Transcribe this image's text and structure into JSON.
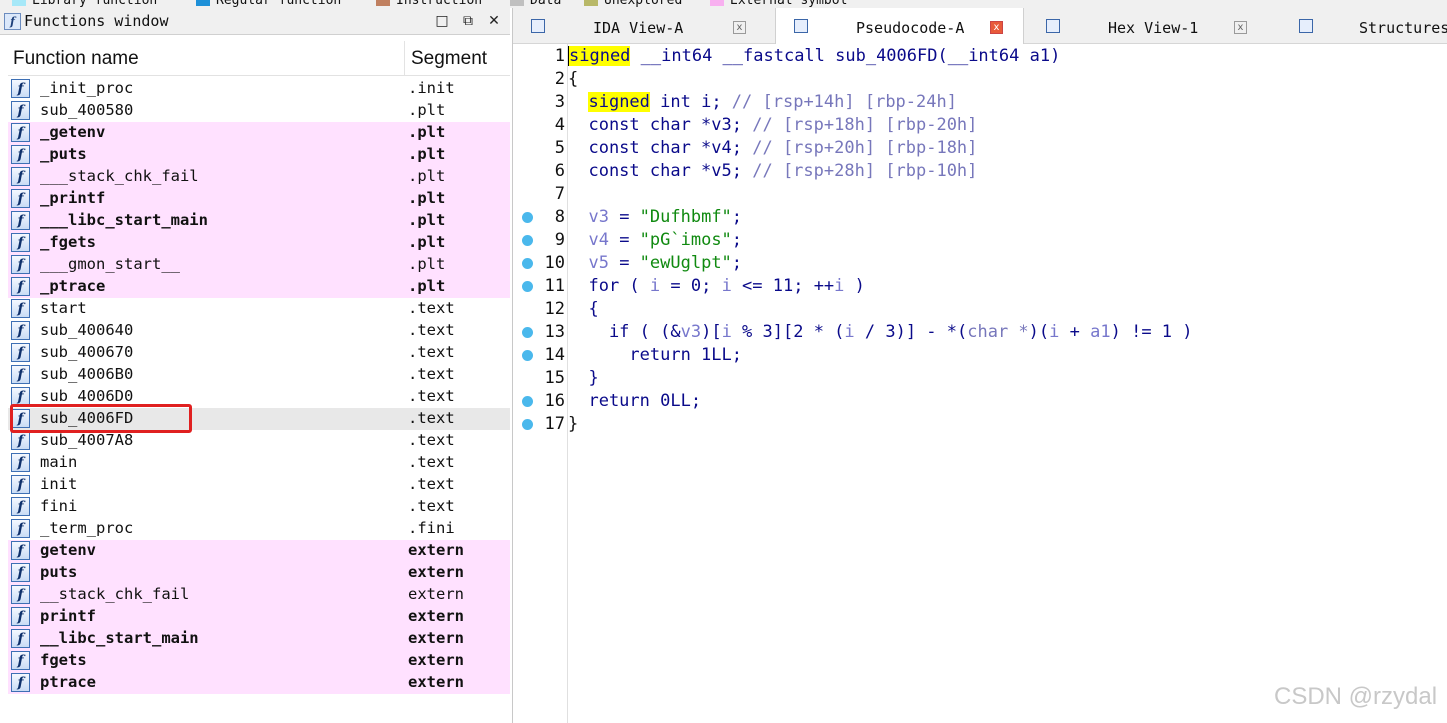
{
  "legend": [
    {
      "label": "Library function",
      "color": "#a6e8f8"
    },
    {
      "label": "Regular function",
      "color": "#1e90d8"
    },
    {
      "label": "Instruction",
      "color": "#c08060"
    },
    {
      "label": "Data",
      "color": "#c0c0c0"
    },
    {
      "label": "Unexplored",
      "color": "#b8b868"
    },
    {
      "label": "External symbol",
      "color": "#f8b0f0"
    }
  ],
  "functions_window": {
    "title": "Functions window",
    "restore_btn": "□",
    "float_btn": "⧉",
    "close_btn": "✕",
    "col_name": "Function name",
    "col_segment": "Segment",
    "rows": [
      {
        "name": "_init_proc",
        "segment": ".init",
        "style": "normal"
      },
      {
        "name": "sub_400580",
        "segment": ".plt",
        "style": "normal"
      },
      {
        "name": "_getenv",
        "segment": ".plt",
        "style": "extbold"
      },
      {
        "name": "_puts",
        "segment": ".plt",
        "style": "extbold"
      },
      {
        "name": "___stack_chk_fail",
        "segment": ".plt",
        "style": "ext"
      },
      {
        "name": "_printf",
        "segment": ".plt",
        "style": "extbold"
      },
      {
        "name": "___libc_start_main",
        "segment": ".plt",
        "style": "extbold"
      },
      {
        "name": "_fgets",
        "segment": ".plt",
        "style": "extbold"
      },
      {
        "name": "___gmon_start__",
        "segment": ".plt",
        "style": "ext"
      },
      {
        "name": "_ptrace",
        "segment": ".plt",
        "style": "extbold"
      },
      {
        "name": "start",
        "segment": ".text",
        "style": "normal"
      },
      {
        "name": "sub_400640",
        "segment": ".text",
        "style": "normal"
      },
      {
        "name": "sub_400670",
        "segment": ".text",
        "style": "normal"
      },
      {
        "name": "sub_4006B0",
        "segment": ".text",
        "style": "normal"
      },
      {
        "name": "sub_4006D0",
        "segment": ".text",
        "style": "normal"
      },
      {
        "name": "sub_4006FD",
        "segment": ".text",
        "style": "selected"
      },
      {
        "name": "sub_4007A8",
        "segment": ".text",
        "style": "normal"
      },
      {
        "name": "main",
        "segment": ".text",
        "style": "normal"
      },
      {
        "name": "init",
        "segment": ".text",
        "style": "normal"
      },
      {
        "name": "fini",
        "segment": ".text",
        "style": "normal"
      },
      {
        "name": "_term_proc",
        "segment": ".fini",
        "style": "normal"
      },
      {
        "name": "getenv",
        "segment": "extern",
        "style": "extbold"
      },
      {
        "name": "puts",
        "segment": "extern",
        "style": "extbold"
      },
      {
        "name": "__stack_chk_fail",
        "segment": "extern",
        "style": "ext"
      },
      {
        "name": "printf",
        "segment": "extern",
        "style": "extbold"
      },
      {
        "name": "__libc_start_main",
        "segment": "extern",
        "style": "extbold"
      },
      {
        "name": "fgets",
        "segment": "extern",
        "style": "extbold"
      },
      {
        "name": "ptrace",
        "segment": "extern",
        "style": "extbold"
      }
    ]
  },
  "tabs": [
    {
      "label": "IDA View-A",
      "active": false,
      "close": "x"
    },
    {
      "label": "Pseudocode-A",
      "active": true,
      "close": "x"
    },
    {
      "label": "Hex View-1",
      "active": false,
      "close": "x"
    },
    {
      "label": "Structures",
      "active": false,
      "close": ""
    }
  ],
  "code_lines": [
    {
      "n": "1",
      "bp": false,
      "parts": [
        [
          "hl",
          "signed"
        ],
        [
          "",
          " "
        ],
        [
          "kw",
          "__int64 __fastcall sub_4006FD(__int64 a1)"
        ]
      ]
    },
    {
      "n": "2",
      "bp": false,
      "parts": [
        [
          "",
          "{"
        ]
      ]
    },
    {
      "n": "3",
      "bp": false,
      "parts": [
        [
          "",
          "  "
        ],
        [
          "hl",
          "signed"
        ],
        [
          "kw",
          " int i; "
        ],
        [
          "cmt",
          "// [rsp+14h] [rbp-24h]"
        ]
      ]
    },
    {
      "n": "4",
      "bp": false,
      "parts": [
        [
          "kw",
          "  const char *v3; "
        ],
        [
          "cmt",
          "// [rsp+18h] [rbp-20h]"
        ]
      ]
    },
    {
      "n": "5",
      "bp": false,
      "parts": [
        [
          "kw",
          "  const char *v4; "
        ],
        [
          "cmt",
          "// [rsp+20h] [rbp-18h]"
        ]
      ]
    },
    {
      "n": "6",
      "bp": false,
      "parts": [
        [
          "kw",
          "  const char *v5; "
        ],
        [
          "cmt",
          "// [rsp+28h] [rbp-10h]"
        ]
      ]
    },
    {
      "n": "7",
      "bp": false,
      "parts": [
        [
          "",
          ""
        ]
      ]
    },
    {
      "n": "8",
      "bp": true,
      "parts": [
        [
          "var",
          "  v3"
        ],
        [
          "kw",
          " = "
        ],
        [
          "str",
          "\"Dufhbmf\""
        ],
        [
          "kw",
          ";"
        ]
      ]
    },
    {
      "n": "9",
      "bp": true,
      "parts": [
        [
          "var",
          "  v4"
        ],
        [
          "kw",
          " = "
        ],
        [
          "str",
          "\"pG`imos\""
        ],
        [
          "kw",
          ";"
        ]
      ]
    },
    {
      "n": "10",
      "bp": true,
      "parts": [
        [
          "var",
          "  v5"
        ],
        [
          "kw",
          " = "
        ],
        [
          "str",
          "\"ewUglpt\""
        ],
        [
          "kw",
          ";"
        ]
      ]
    },
    {
      "n": "11",
      "bp": true,
      "parts": [
        [
          "kw",
          "  for ( "
        ],
        [
          "var",
          "i"
        ],
        [
          "kw",
          " = 0; "
        ],
        [
          "var",
          "i"
        ],
        [
          "kw",
          " <= 11; ++"
        ],
        [
          "var",
          "i"
        ],
        [
          "kw",
          " )"
        ]
      ]
    },
    {
      "n": "12",
      "bp": false,
      "parts": [
        [
          "kw",
          "  {"
        ]
      ]
    },
    {
      "n": "13",
      "bp": true,
      "parts": [
        [
          "kw",
          "    if ( (&"
        ],
        [
          "var",
          "v3"
        ],
        [
          "kw",
          ")["
        ],
        [
          "var",
          "i"
        ],
        [
          "kw",
          " % 3][2 * ("
        ],
        [
          "var",
          "i"
        ],
        [
          "kw",
          " / 3)] - *("
        ],
        [
          "cmt",
          "char *"
        ],
        [
          "kw",
          ")("
        ],
        [
          "var",
          "i"
        ],
        [
          "kw",
          " + "
        ],
        [
          "var",
          "a1"
        ],
        [
          "kw",
          ") != 1 )"
        ]
      ]
    },
    {
      "n": "14",
      "bp": true,
      "parts": [
        [
          "kw",
          "      return 1LL;"
        ]
      ]
    },
    {
      "n": "15",
      "bp": false,
      "parts": [
        [
          "kw",
          "  }"
        ]
      ]
    },
    {
      "n": "16",
      "bp": true,
      "parts": [
        [
          "kw",
          "  return 0LL;"
        ]
      ]
    },
    {
      "n": "17",
      "bp": true,
      "parts": [
        [
          "",
          "}"
        ]
      ]
    }
  ],
  "watermark": "CSDN @rzydal"
}
